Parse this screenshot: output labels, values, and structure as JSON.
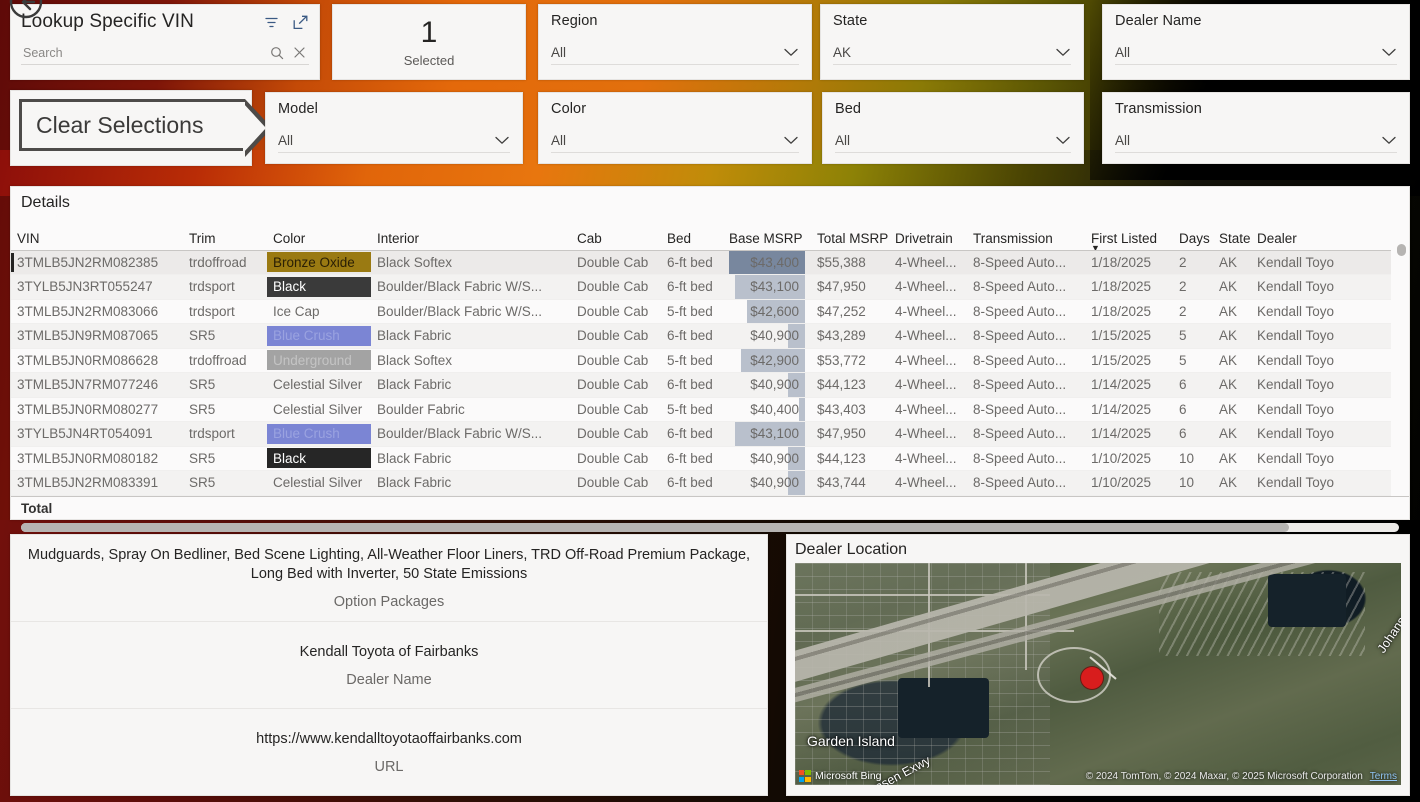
{
  "vin_slicer": {
    "title": "Lookup Specific VIN",
    "search_placeholder": "Search",
    "search_value": "",
    "filter_icon": "filter-icon",
    "focus_icon": "focus-mode-icon",
    "search_icon": "search-icon",
    "clear_icon": "clear-icon"
  },
  "kpi": {
    "value": "1",
    "label": "Selected"
  },
  "clear_button": {
    "label": "Clear Selections"
  },
  "filters": [
    {
      "name": "model",
      "label": "Model",
      "value": "All"
    },
    {
      "name": "region",
      "label": "Region",
      "value": "All"
    },
    {
      "name": "state",
      "label": "State",
      "value": "AK"
    },
    {
      "name": "dealer-name",
      "label": "Dealer Name",
      "value": "All"
    },
    {
      "name": "color",
      "label": "Color",
      "value": "All"
    },
    {
      "name": "bed",
      "label": "Bed",
      "value": "All"
    },
    {
      "name": "transmission",
      "label": "Transmission",
      "value": "All"
    }
  ],
  "details": {
    "title": "Details",
    "total_label": "Total",
    "sort_column": "First Listed",
    "sort_direction": "desc",
    "columns": [
      "VIN",
      "Trim",
      "Color",
      "Interior",
      "Cab",
      "Bed",
      "Base MSRP",
      "Total MSRP",
      "Drivetrain",
      "Transmission",
      "First Listed",
      "Days",
      "State",
      "Dealer"
    ],
    "rows": [
      {
        "vin": "3TMLB5JN2RM082385",
        "trim": "trdoffroad",
        "color": "Bronze Oxide",
        "color_swatch": "#9a7a12",
        "color_text": "#2b2005",
        "interior": "Black Softex",
        "cab": "Double Cab",
        "bed": "6-ft bed",
        "base_msrp": "$43,400",
        "bar_pct": 100,
        "total_msrp": "$55,388",
        "drivetrain": "4-Wheel...",
        "transmission": "8-Speed Auto...",
        "first_listed": "1/18/2025",
        "days": "2",
        "state": "AK",
        "dealer": "Kendall Toyo",
        "selected": true
      },
      {
        "vin": "3TYLB5JN3RT055247",
        "trim": "trdsport",
        "color": "Black",
        "color_swatch": "#3a3a3a",
        "color_text": "#ffffff",
        "interior": "Boulder/Black Fabric W/S...",
        "cab": "Double Cab",
        "bed": "6-ft bed",
        "base_msrp": "$43,100",
        "bar_pct": 92,
        "total_msrp": "$47,950",
        "drivetrain": "4-Wheel...",
        "transmission": "8-Speed Auto...",
        "first_listed": "1/18/2025",
        "days": "2",
        "state": "AK",
        "dealer": "Kendall Toyo",
        "selected": false
      },
      {
        "vin": "3TMLB5JN2RM083066",
        "trim": "trdsport",
        "color": "Ice Cap",
        "color_swatch": "",
        "color_text": "#6c6a68",
        "interior": "Boulder/Black Fabric W/S...",
        "cab": "Double Cab",
        "bed": "5-ft bed",
        "base_msrp": "$42,600",
        "bar_pct": 76,
        "total_msrp": "$47,252",
        "drivetrain": "4-Wheel...",
        "transmission": "8-Speed Auto...",
        "first_listed": "1/18/2025",
        "days": "2",
        "state": "AK",
        "dealer": "Kendall Toyo",
        "selected": false
      },
      {
        "vin": "3TMLB5JN9RM087065",
        "trim": "SR5",
        "color": "Blue Crush",
        "color_swatch": "#7b85d4",
        "color_text": "#9aa2e0",
        "interior": "Black Fabric",
        "cab": "Double Cab",
        "bed": "6-ft bed",
        "base_msrp": "$40,900",
        "bar_pct": 22,
        "total_msrp": "$43,289",
        "drivetrain": "4-Wheel...",
        "transmission": "8-Speed Auto...",
        "first_listed": "1/15/2025",
        "days": "5",
        "state": "AK",
        "dealer": "Kendall Toyo",
        "selected": false
      },
      {
        "vin": "3TMLB5JN0RM086628",
        "trim": "trdoffroad",
        "color": "Underground",
        "color_swatch": "#a3a3a3",
        "color_text": "#c4c4c4",
        "interior": "Black Softex",
        "cab": "Double Cab",
        "bed": "5-ft bed",
        "base_msrp": "$42,900",
        "bar_pct": 84,
        "total_msrp": "$53,772",
        "drivetrain": "4-Wheel...",
        "transmission": "8-Speed Auto...",
        "first_listed": "1/15/2025",
        "days": "5",
        "state": "AK",
        "dealer": "Kendall Toyo",
        "selected": false
      },
      {
        "vin": "3TMLB5JN7RM077246",
        "trim": "SR5",
        "color": "Celestial Silver",
        "color_swatch": "",
        "color_text": "#6c6a68",
        "interior": "Black Fabric",
        "cab": "Double Cab",
        "bed": "6-ft bed",
        "base_msrp": "$40,900",
        "bar_pct": 22,
        "total_msrp": "$44,123",
        "drivetrain": "4-Wheel...",
        "transmission": "8-Speed Auto...",
        "first_listed": "1/14/2025",
        "days": "6",
        "state": "AK",
        "dealer": "Kendall Toyo",
        "selected": false
      },
      {
        "vin": "3TMLB5JN0RM080277",
        "trim": "SR5",
        "color": "Celestial Silver",
        "color_swatch": "",
        "color_text": "#6c6a68",
        "interior": "Boulder Fabric",
        "cab": "Double Cab",
        "bed": "5-ft bed",
        "base_msrp": "$40,400",
        "bar_pct": 8,
        "total_msrp": "$43,403",
        "drivetrain": "4-Wheel...",
        "transmission": "8-Speed Auto...",
        "first_listed": "1/14/2025",
        "days": "6",
        "state": "AK",
        "dealer": "Kendall Toyo",
        "selected": false
      },
      {
        "vin": "3TYLB5JN4RT054091",
        "trim": "trdsport",
        "color": "Blue Crush",
        "color_swatch": "#7b85d4",
        "color_text": "#9aa2e0",
        "interior": "Boulder/Black Fabric W/S...",
        "cab": "Double Cab",
        "bed": "6-ft bed",
        "base_msrp": "$43,100",
        "bar_pct": 92,
        "total_msrp": "$47,950",
        "drivetrain": "4-Wheel...",
        "transmission": "8-Speed Auto...",
        "first_listed": "1/14/2025",
        "days": "6",
        "state": "AK",
        "dealer": "Kendall Toyo",
        "selected": false
      },
      {
        "vin": "3TMLB5JN0RM080182",
        "trim": "SR5",
        "color": "Black",
        "color_swatch": "#262626",
        "color_text": "#ffffff",
        "interior": "Black Fabric",
        "cab": "Double Cab",
        "bed": "6-ft bed",
        "base_msrp": "$40,900",
        "bar_pct": 22,
        "total_msrp": "$44,123",
        "drivetrain": "4-Wheel...",
        "transmission": "8-Speed Auto...",
        "first_listed": "1/10/2025",
        "days": "10",
        "state": "AK",
        "dealer": "Kendall Toyo",
        "selected": false
      },
      {
        "vin": "3TMLB5JN2RM083391",
        "trim": "SR5",
        "color": "Celestial Silver",
        "color_swatch": "",
        "color_text": "#6c6a68",
        "interior": "Black Fabric",
        "cab": "Double Cab",
        "bed": "6-ft bed",
        "base_msrp": "$40,900",
        "bar_pct": 22,
        "total_msrp": "$43,744",
        "drivetrain": "4-Wheel...",
        "transmission": "8-Speed Auto...",
        "first_listed": "1/10/2025",
        "days": "10",
        "state": "AK",
        "dealer": "Kendall Toyo",
        "selected": false
      }
    ]
  },
  "info_card": {
    "option_packages_value": "Mudguards, Spray On Bedliner, Bed Scene Lighting, All-Weather Floor Liners, TRD Off-Road Premium Package, Long Bed with Inverter, 50 State Emissions",
    "option_packages_caption": "Option Packages",
    "dealer_name_value": "Kendall Toyota of Fairbanks",
    "dealer_name_caption": "Dealer Name",
    "url_value": "https://www.kendalltoyotaoffairbanks.com",
    "url_caption": "URL"
  },
  "map": {
    "title": "Dealer Location",
    "provider": "Microsoft Bing",
    "attribution": "© 2024 TomTom, © 2024 Maxar, © 2025 Microsoft Corporation",
    "terms": "Terms",
    "labels": {
      "garden_island": "Garden Island",
      "johansen_expressway": "Johansen Exwy",
      "johansen_right": "Johanse"
    }
  }
}
